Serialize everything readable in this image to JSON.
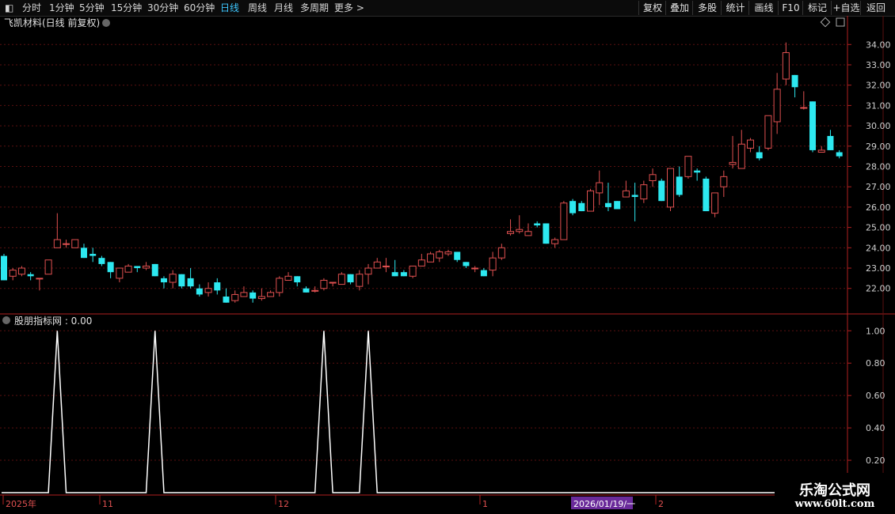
{
  "toolbar": {
    "periods": [
      "分时",
      "1分钟",
      "5分钟",
      "15分钟",
      "30分钟",
      "60分钟",
      "日线",
      "周线",
      "月线",
      "多周期",
      "更多 >"
    ],
    "active_period": "日线",
    "right_buttons": [
      "复权",
      "叠加",
      "多股",
      "统计",
      "画线",
      "F10",
      "标记",
      "+自选",
      "返回"
    ]
  },
  "main_title": "飞凯材料(日线 前复权)",
  "indicator_title": "股朋指标网 : 0.00",
  "date_axis": {
    "labels": [
      "2025年",
      "11",
      "12",
      "1",
      "2"
    ],
    "highlight": "2026/01/19/一"
  },
  "watermark": {
    "line1": "乐淘公式网",
    "line2": "www.60lt.com"
  },
  "colors": {
    "up": "#e05050",
    "down": "#2de8f0",
    "grid": "#5a1010",
    "axis": "#b02020",
    "indicator": "#ffffff",
    "highlight_bg": "#6a2a9a"
  },
  "chart_data": [
    {
      "type": "candlestick",
      "ylim": [
        20.9,
        34.4
      ],
      "yticks": [
        22,
        23,
        24,
        25,
        26,
        27,
        28,
        29,
        30,
        31,
        32,
        33,
        34
      ],
      "ytick_labels": [
        "22.00",
        "23.00",
        "24.00",
        "25.00",
        "26.00",
        "27.00",
        "28.00",
        "29.00",
        "30.00",
        "31.00",
        "32.00",
        "33.00",
        "34.00"
      ],
      "ohlc": [
        [
          23.6,
          23.7,
          22.4,
          22.4
        ],
        [
          22.6,
          23.0,
          22.4,
          22.9
        ],
        [
          22.7,
          23.1,
          22.6,
          23.0
        ],
        [
          22.7,
          22.8,
          22.4,
          22.6
        ],
        [
          22.5,
          22.5,
          21.9,
          22.5
        ],
        [
          22.7,
          23.4,
          22.7,
          23.4
        ],
        [
          24.0,
          25.7,
          24.0,
          24.4
        ],
        [
          24.2,
          24.4,
          24.0,
          24.2
        ],
        [
          24.0,
          24.4,
          24.0,
          24.4
        ],
        [
          24.0,
          24.2,
          23.5,
          23.5
        ],
        [
          23.7,
          24.0,
          23.3,
          23.6
        ],
        [
          23.5,
          23.6,
          23.1,
          23.2
        ],
        [
          23.3,
          23.3,
          22.5,
          22.8
        ],
        [
          22.5,
          23.0,
          22.3,
          23.0
        ],
        [
          22.8,
          23.2,
          22.8,
          23.1
        ],
        [
          23.1,
          23.1,
          22.8,
          23.0
        ],
        [
          23.0,
          23.3,
          22.9,
          23.1
        ],
        [
          23.2,
          23.2,
          22.6,
          22.6
        ],
        [
          22.5,
          22.6,
          22.0,
          22.3
        ],
        [
          22.3,
          22.9,
          22.0,
          22.7
        ],
        [
          22.7,
          22.7,
          22.0,
          22.1
        ],
        [
          22.5,
          23.0,
          22.0,
          22.1
        ],
        [
          22.0,
          22.2,
          21.6,
          21.7
        ],
        [
          21.8,
          22.3,
          21.6,
          22.0
        ],
        [
          22.3,
          22.5,
          21.7,
          21.9
        ],
        [
          21.6,
          22.0,
          21.3,
          21.3
        ],
        [
          21.4,
          21.9,
          21.3,
          21.7
        ],
        [
          21.6,
          22.1,
          21.6,
          21.8
        ],
        [
          21.8,
          21.9,
          21.3,
          21.5
        ],
        [
          21.5,
          22.0,
          21.4,
          21.6
        ],
        [
          21.6,
          21.9,
          21.6,
          21.8
        ],
        [
          21.8,
          22.6,
          21.6,
          22.5
        ],
        [
          22.4,
          22.8,
          22.4,
          22.6
        ],
        [
          22.6,
          22.6,
          22.1,
          22.3
        ],
        [
          22.0,
          22.1,
          21.8,
          21.8
        ],
        [
          21.9,
          22.1,
          21.8,
          21.9
        ],
        [
          22.0,
          22.5,
          21.9,
          22.4
        ],
        [
          22.3,
          22.3,
          22.1,
          22.3
        ],
        [
          22.2,
          22.8,
          22.2,
          22.7
        ],
        [
          22.7,
          22.7,
          22.2,
          22.3
        ],
        [
          22.1,
          22.9,
          21.9,
          22.7
        ],
        [
          22.7,
          23.2,
          22.2,
          23.0
        ],
        [
          23.0,
          23.5,
          23.0,
          23.3
        ],
        [
          23.1,
          23.5,
          22.8,
          23.1
        ],
        [
          22.8,
          23.4,
          22.6,
          22.6
        ],
        [
          22.8,
          22.9,
          22.6,
          22.6
        ],
        [
          22.6,
          23.1,
          22.5,
          23.1
        ],
        [
          23.1,
          23.7,
          23.1,
          23.4
        ],
        [
          23.3,
          23.8,
          23.3,
          23.7
        ],
        [
          23.5,
          23.9,
          23.3,
          23.8
        ],
        [
          23.7,
          23.9,
          23.6,
          23.8
        ],
        [
          23.8,
          23.8,
          23.3,
          23.4
        ],
        [
          23.3,
          23.3,
          23.0,
          23.1
        ],
        [
          23.0,
          23.1,
          22.8,
          23.0
        ],
        [
          22.9,
          23.0,
          22.6,
          22.6
        ],
        [
          22.9,
          23.8,
          22.6,
          23.5
        ],
        [
          23.5,
          24.2,
          23.4,
          24.0
        ],
        [
          24.7,
          25.4,
          24.6,
          24.8
        ],
        [
          24.8,
          25.6,
          24.7,
          24.9
        ],
        [
          24.6,
          25.2,
          24.6,
          24.8
        ],
        [
          25.2,
          25.3,
          25.0,
          25.1
        ],
        [
          25.2,
          25.2,
          24.2,
          24.2
        ],
        [
          24.2,
          24.5,
          24.0,
          24.4
        ],
        [
          24.4,
          26.3,
          24.4,
          26.2
        ],
        [
          26.3,
          26.4,
          25.6,
          25.7
        ],
        [
          26.2,
          26.3,
          25.8,
          25.8
        ],
        [
          25.8,
          26.9,
          25.8,
          26.8
        ],
        [
          26.7,
          27.8,
          26.1,
          27.2
        ],
        [
          26.2,
          27.2,
          25.8,
          26.0
        ],
        [
          26.3,
          26.3,
          25.9,
          25.9
        ],
        [
          26.5,
          27.3,
          26.5,
          26.8
        ],
        [
          26.6,
          27.2,
          25.3,
          26.5
        ],
        [
          26.4,
          27.3,
          26.2,
          27.1
        ],
        [
          27.3,
          27.9,
          27.0,
          27.6
        ],
        [
          27.3,
          27.4,
          26.3,
          26.3
        ],
        [
          26.0,
          27.7,
          25.8,
          27.9
        ],
        [
          27.5,
          28.0,
          26.5,
          26.6
        ],
        [
          27.5,
          28.4,
          27.4,
          28.5
        ],
        [
          27.8,
          27.9,
          27.3,
          27.7
        ],
        [
          27.4,
          27.5,
          25.8,
          25.8
        ],
        [
          25.7,
          26.6,
          25.5,
          26.7
        ],
        [
          27.0,
          27.8,
          26.5,
          27.5
        ],
        [
          28.1,
          29.5,
          27.9,
          28.2
        ],
        [
          27.9,
          29.8,
          27.9,
          29.1
        ],
        [
          28.9,
          29.4,
          28.7,
          29.3
        ],
        [
          28.7,
          29.0,
          28.3,
          28.4
        ],
        [
          28.9,
          30.5,
          28.8,
          30.5
        ],
        [
          30.2,
          32.6,
          29.6,
          31.8
        ],
        [
          32.3,
          34.1,
          32.0,
          33.6
        ],
        [
          32.5,
          32.5,
          31.4,
          31.9
        ],
        [
          30.9,
          31.7,
          30.8,
          30.9
        ],
        [
          31.2,
          31.2,
          28.7,
          28.8
        ],
        [
          28.7,
          29.0,
          28.7,
          28.8
        ],
        [
          29.5,
          29.8,
          28.8,
          28.8
        ],
        [
          28.7,
          28.8,
          28.4,
          28.5
        ]
      ]
    },
    {
      "type": "line",
      "name": "股朋指标网",
      "ylim": [
        0,
        1.06
      ],
      "yticks": [
        0.2,
        0.4,
        0.6,
        0.8,
        1.0
      ],
      "ytick_labels": [
        "0.20",
        "0.40",
        "0.60",
        "0.80",
        "1.00"
      ],
      "peaks": [
        6,
        17,
        36,
        41
      ],
      "values_note_current": 0.0
    }
  ]
}
